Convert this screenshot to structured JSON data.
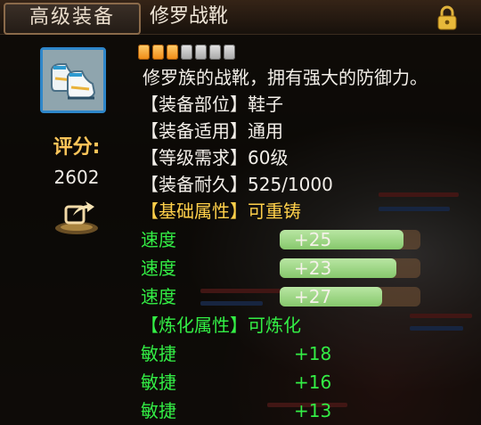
{
  "header": {
    "tab_label": "高级装备",
    "item_name": "修罗战靴"
  },
  "icons": {
    "lock": "lock-icon",
    "item": "boots-icon",
    "share": "share-icon"
  },
  "rating": {
    "filled": 3,
    "total": 7
  },
  "score": {
    "label": "评分:",
    "value": "2602"
  },
  "description": "修罗族的战靴，拥有强大的防御力。",
  "info_rows": [
    {
      "key": "装备部位",
      "value": "鞋子"
    },
    {
      "key": "装备适用",
      "value": "通用"
    },
    {
      "key": "等级需求",
      "value": "60级"
    },
    {
      "key": "装备耐久",
      "value": "525/1000"
    }
  ],
  "base_section": {
    "key": "基础属性",
    "value": "可重铸"
  },
  "base_stats": [
    {
      "name": "速度",
      "value": "+25",
      "fill": 0.88
    },
    {
      "name": "速度",
      "value": "+23",
      "fill": 0.83
    },
    {
      "name": "速度",
      "value": "+27",
      "fill": 0.73
    }
  ],
  "refine_section": {
    "key": "炼化属性",
    "value": "可炼化"
  },
  "refine_stats": [
    {
      "name": "敏捷",
      "value": "+18"
    },
    {
      "name": "敏捷",
      "value": "+16"
    },
    {
      "name": "敏捷",
      "value": "+13"
    }
  ],
  "colors": {
    "accent_gold": "#ffd04a",
    "stat_green": "#33ee45",
    "icon_border": "#2e86c9"
  }
}
